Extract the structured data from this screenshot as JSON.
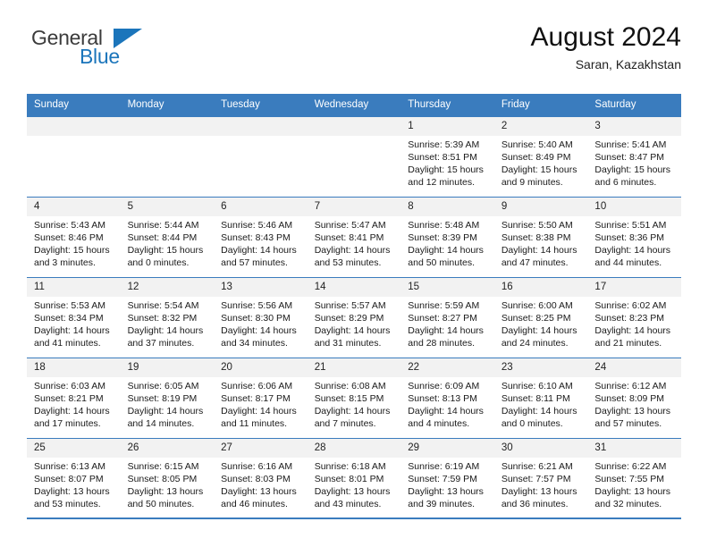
{
  "brand": {
    "name_part1": "General",
    "name_part2": "Blue",
    "triangle_icon": "triangle-icon",
    "colors": {
      "blue": "#1b75bb",
      "dark": "#3b3b3b"
    }
  },
  "header": {
    "title": "August 2024",
    "subtitle": "Saran, Kazakhstan"
  },
  "calendar": {
    "header_color": "#3a7cbe",
    "weekdays": [
      "Sunday",
      "Monday",
      "Tuesday",
      "Wednesday",
      "Thursday",
      "Friday",
      "Saturday"
    ],
    "weeks": [
      [
        {
          "day": "",
          "empty": true,
          "lines": []
        },
        {
          "day": "",
          "empty": true,
          "lines": []
        },
        {
          "day": "",
          "empty": true,
          "lines": []
        },
        {
          "day": "",
          "empty": true,
          "lines": []
        },
        {
          "day": "1",
          "sunrise": "Sunrise: 5:39 AM",
          "sunset": "Sunset: 8:51 PM",
          "daylight1": "Daylight: 15 hours",
          "daylight2": "and 12 minutes."
        },
        {
          "day": "2",
          "sunrise": "Sunrise: 5:40 AM",
          "sunset": "Sunset: 8:49 PM",
          "daylight1": "Daylight: 15 hours",
          "daylight2": "and 9 minutes."
        },
        {
          "day": "3",
          "sunrise": "Sunrise: 5:41 AM",
          "sunset": "Sunset: 8:47 PM",
          "daylight1": "Daylight: 15 hours",
          "daylight2": "and 6 minutes."
        }
      ],
      [
        {
          "day": "4",
          "sunrise": "Sunrise: 5:43 AM",
          "sunset": "Sunset: 8:46 PM",
          "daylight1": "Daylight: 15 hours",
          "daylight2": "and 3 minutes."
        },
        {
          "day": "5",
          "sunrise": "Sunrise: 5:44 AM",
          "sunset": "Sunset: 8:44 PM",
          "daylight1": "Daylight: 15 hours",
          "daylight2": "and 0 minutes."
        },
        {
          "day": "6",
          "sunrise": "Sunrise: 5:46 AM",
          "sunset": "Sunset: 8:43 PM",
          "daylight1": "Daylight: 14 hours",
          "daylight2": "and 57 minutes."
        },
        {
          "day": "7",
          "sunrise": "Sunrise: 5:47 AM",
          "sunset": "Sunset: 8:41 PM",
          "daylight1": "Daylight: 14 hours",
          "daylight2": "and 53 minutes."
        },
        {
          "day": "8",
          "sunrise": "Sunrise: 5:48 AM",
          "sunset": "Sunset: 8:39 PM",
          "daylight1": "Daylight: 14 hours",
          "daylight2": "and 50 minutes."
        },
        {
          "day": "9",
          "sunrise": "Sunrise: 5:50 AM",
          "sunset": "Sunset: 8:38 PM",
          "daylight1": "Daylight: 14 hours",
          "daylight2": "and 47 minutes."
        },
        {
          "day": "10",
          "sunrise": "Sunrise: 5:51 AM",
          "sunset": "Sunset: 8:36 PM",
          "daylight1": "Daylight: 14 hours",
          "daylight2": "and 44 minutes."
        }
      ],
      [
        {
          "day": "11",
          "sunrise": "Sunrise: 5:53 AM",
          "sunset": "Sunset: 8:34 PM",
          "daylight1": "Daylight: 14 hours",
          "daylight2": "and 41 minutes."
        },
        {
          "day": "12",
          "sunrise": "Sunrise: 5:54 AM",
          "sunset": "Sunset: 8:32 PM",
          "daylight1": "Daylight: 14 hours",
          "daylight2": "and 37 minutes."
        },
        {
          "day": "13",
          "sunrise": "Sunrise: 5:56 AM",
          "sunset": "Sunset: 8:30 PM",
          "daylight1": "Daylight: 14 hours",
          "daylight2": "and 34 minutes."
        },
        {
          "day": "14",
          "sunrise": "Sunrise: 5:57 AM",
          "sunset": "Sunset: 8:29 PM",
          "daylight1": "Daylight: 14 hours",
          "daylight2": "and 31 minutes."
        },
        {
          "day": "15",
          "sunrise": "Sunrise: 5:59 AM",
          "sunset": "Sunset: 8:27 PM",
          "daylight1": "Daylight: 14 hours",
          "daylight2": "and 28 minutes."
        },
        {
          "day": "16",
          "sunrise": "Sunrise: 6:00 AM",
          "sunset": "Sunset: 8:25 PM",
          "daylight1": "Daylight: 14 hours",
          "daylight2": "and 24 minutes."
        },
        {
          "day": "17",
          "sunrise": "Sunrise: 6:02 AM",
          "sunset": "Sunset: 8:23 PM",
          "daylight1": "Daylight: 14 hours",
          "daylight2": "and 21 minutes."
        }
      ],
      [
        {
          "day": "18",
          "sunrise": "Sunrise: 6:03 AM",
          "sunset": "Sunset: 8:21 PM",
          "daylight1": "Daylight: 14 hours",
          "daylight2": "and 17 minutes."
        },
        {
          "day": "19",
          "sunrise": "Sunrise: 6:05 AM",
          "sunset": "Sunset: 8:19 PM",
          "daylight1": "Daylight: 14 hours",
          "daylight2": "and 14 minutes."
        },
        {
          "day": "20",
          "sunrise": "Sunrise: 6:06 AM",
          "sunset": "Sunset: 8:17 PM",
          "daylight1": "Daylight: 14 hours",
          "daylight2": "and 11 minutes."
        },
        {
          "day": "21",
          "sunrise": "Sunrise: 6:08 AM",
          "sunset": "Sunset: 8:15 PM",
          "daylight1": "Daylight: 14 hours",
          "daylight2": "and 7 minutes."
        },
        {
          "day": "22",
          "sunrise": "Sunrise: 6:09 AM",
          "sunset": "Sunset: 8:13 PM",
          "daylight1": "Daylight: 14 hours",
          "daylight2": "and 4 minutes."
        },
        {
          "day": "23",
          "sunrise": "Sunrise: 6:10 AM",
          "sunset": "Sunset: 8:11 PM",
          "daylight1": "Daylight: 14 hours",
          "daylight2": "and 0 minutes."
        },
        {
          "day": "24",
          "sunrise": "Sunrise: 6:12 AM",
          "sunset": "Sunset: 8:09 PM",
          "daylight1": "Daylight: 13 hours",
          "daylight2": "and 57 minutes."
        }
      ],
      [
        {
          "day": "25",
          "sunrise": "Sunrise: 6:13 AM",
          "sunset": "Sunset: 8:07 PM",
          "daylight1": "Daylight: 13 hours",
          "daylight2": "and 53 minutes."
        },
        {
          "day": "26",
          "sunrise": "Sunrise: 6:15 AM",
          "sunset": "Sunset: 8:05 PM",
          "daylight1": "Daylight: 13 hours",
          "daylight2": "and 50 minutes."
        },
        {
          "day": "27",
          "sunrise": "Sunrise: 6:16 AM",
          "sunset": "Sunset: 8:03 PM",
          "daylight1": "Daylight: 13 hours",
          "daylight2": "and 46 minutes."
        },
        {
          "day": "28",
          "sunrise": "Sunrise: 6:18 AM",
          "sunset": "Sunset: 8:01 PM",
          "daylight1": "Daylight: 13 hours",
          "daylight2": "and 43 minutes."
        },
        {
          "day": "29",
          "sunrise": "Sunrise: 6:19 AM",
          "sunset": "Sunset: 7:59 PM",
          "daylight1": "Daylight: 13 hours",
          "daylight2": "and 39 minutes."
        },
        {
          "day": "30",
          "sunrise": "Sunrise: 6:21 AM",
          "sunset": "Sunset: 7:57 PM",
          "daylight1": "Daylight: 13 hours",
          "daylight2": "and 36 minutes."
        },
        {
          "day": "31",
          "sunrise": "Sunrise: 6:22 AM",
          "sunset": "Sunset: 7:55 PM",
          "daylight1": "Daylight: 13 hours",
          "daylight2": "and 32 minutes."
        }
      ]
    ]
  }
}
